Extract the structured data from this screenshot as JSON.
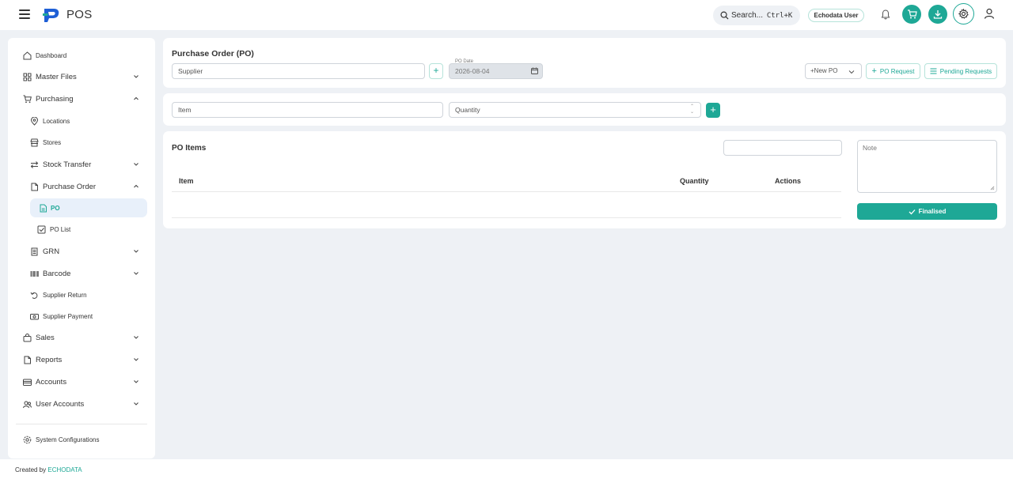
{
  "app": {
    "title": "POS"
  },
  "header": {
    "search_label": "Search...",
    "search_shortcut": "Ctrl+K",
    "user_badge": "Echodata User"
  },
  "sidebar": {
    "dashboard": "Dashboard",
    "master_files": "Master Files",
    "purchasing": "Purchasing",
    "locations": "Locations",
    "stores": "Stores",
    "stock_transfer": "Stock Transfer",
    "purchase_order": "Purchase Order",
    "po": "PO",
    "po_list": "PO List",
    "grn": "GRN",
    "barcode": "Barcode",
    "supplier_return": "Supplier Return",
    "supplier_payment": "Supplier Payment",
    "sales": "Sales",
    "reports": "Reports",
    "accounts": "Accounts",
    "user_accounts": "User Accounts",
    "system_configurations": "System Configurations"
  },
  "form": {
    "title": "Purchase Order (PO)",
    "supplier_placeholder": "Supplier",
    "po_date_label": "PO Date",
    "po_date_value": "2026-08-04",
    "new_po": "+New PO",
    "po_request": "PO Request",
    "pending_requests": "Pending Requests",
    "item_placeholder": "Item",
    "quantity_placeholder": "Quantity"
  },
  "items": {
    "title": "PO Items",
    "columns": [
      "Item",
      "Quantity",
      "Actions"
    ],
    "note_placeholder": "Note",
    "finalised": "Finalised"
  },
  "footer": {
    "created_by": "Created by",
    "brand": "ECHODATA"
  },
  "colors": {
    "accent": "#1ea896",
    "background": "#eef1f5"
  }
}
